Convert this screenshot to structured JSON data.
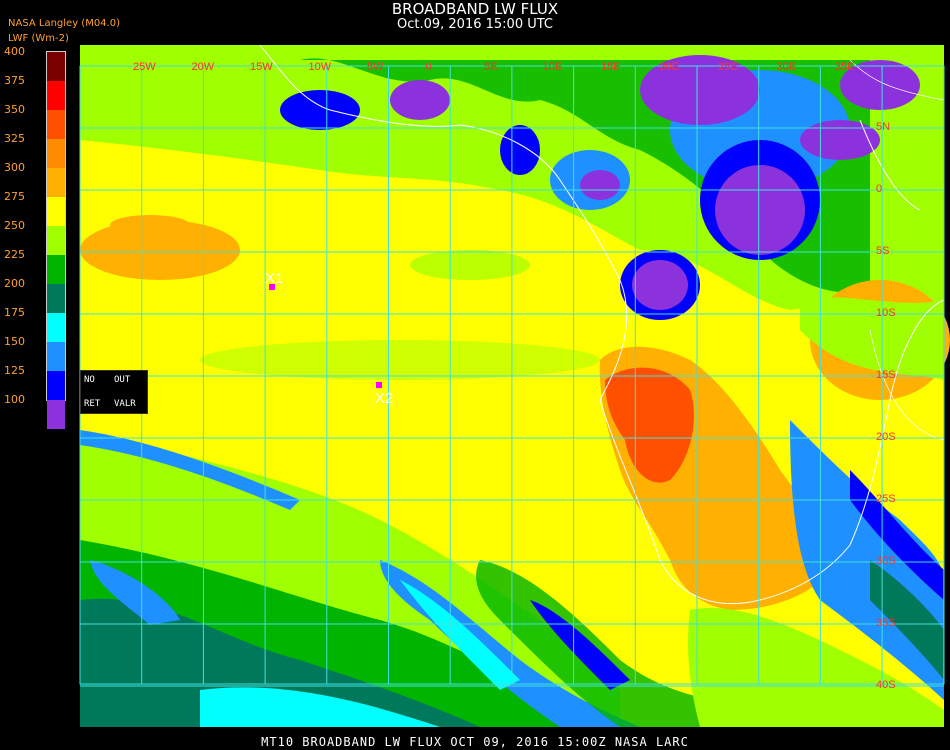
{
  "title": "BROADBAND LW FLUX",
  "subtitle": "Oct.09, 2016 15:00 UTC",
  "source": "NASA Langley (M04.0)",
  "units": "LWF (Wm-2)",
  "legend": {
    "ticks": [
      "400",
      "375",
      "350",
      "325",
      "300",
      "275",
      "250",
      "225",
      "200",
      "175",
      "150",
      "125",
      "100"
    ],
    "colors": [
      "#7a0000",
      "#ff0000",
      "#ff5000",
      "#ff8c00",
      "#ffb000",
      "#ffff00",
      "#a0ff00",
      "#00b400",
      "#00785a",
      "#00ffff",
      "#1e90ff",
      "#0000ff",
      "#8c32dc"
    ]
  },
  "map": {
    "lon_labels": [
      "25W",
      "20W",
      "15W",
      "10W",
      "5W",
      "0",
      "5E",
      "10E",
      "15E",
      "20E",
      "25E",
      "30E",
      "35E"
    ],
    "lat_labels": [
      "5N",
      "0",
      "5S",
      "10S",
      "15S",
      "20S",
      "25S",
      "30S",
      "35S",
      "40S"
    ],
    "markers": [
      {
        "label": "X1",
        "color": "#ff00ff"
      },
      {
        "label": "X2",
        "color": "#ff00ff"
      }
    ]
  },
  "panel": {
    "no": "NO",
    "out": "OUT",
    "ret": "RET",
    "valr": "VALR"
  },
  "footer": "MT10   BROADBAND LW FLUX   OCT 09, 2016 15:00Z   NASA LARC"
}
